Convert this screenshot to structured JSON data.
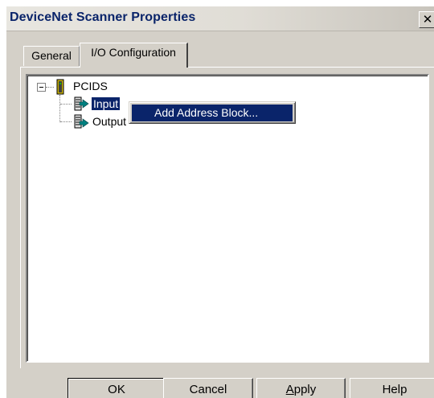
{
  "window": {
    "title": "DeviceNet Scanner Properties",
    "close_glyph": "✕"
  },
  "tabs": [
    {
      "label": "General",
      "active": false
    },
    {
      "label": "I/O Configuration",
      "active": true
    }
  ],
  "tree": {
    "root": {
      "label": "PCIDS",
      "expanded": true
    },
    "children": [
      {
        "label": "Input",
        "selected": true
      },
      {
        "label": "Output",
        "selected": false
      }
    ]
  },
  "context_menu": {
    "items": [
      {
        "label": "Add Address Block..."
      }
    ]
  },
  "buttons": {
    "ok": "OK",
    "cancel": "Cancel",
    "apply_first": "A",
    "apply_rest": "pply",
    "help": "Help"
  },
  "colors": {
    "selection": "#0a246a",
    "face": "#d4d0c8",
    "title_text": "#0a246a"
  }
}
